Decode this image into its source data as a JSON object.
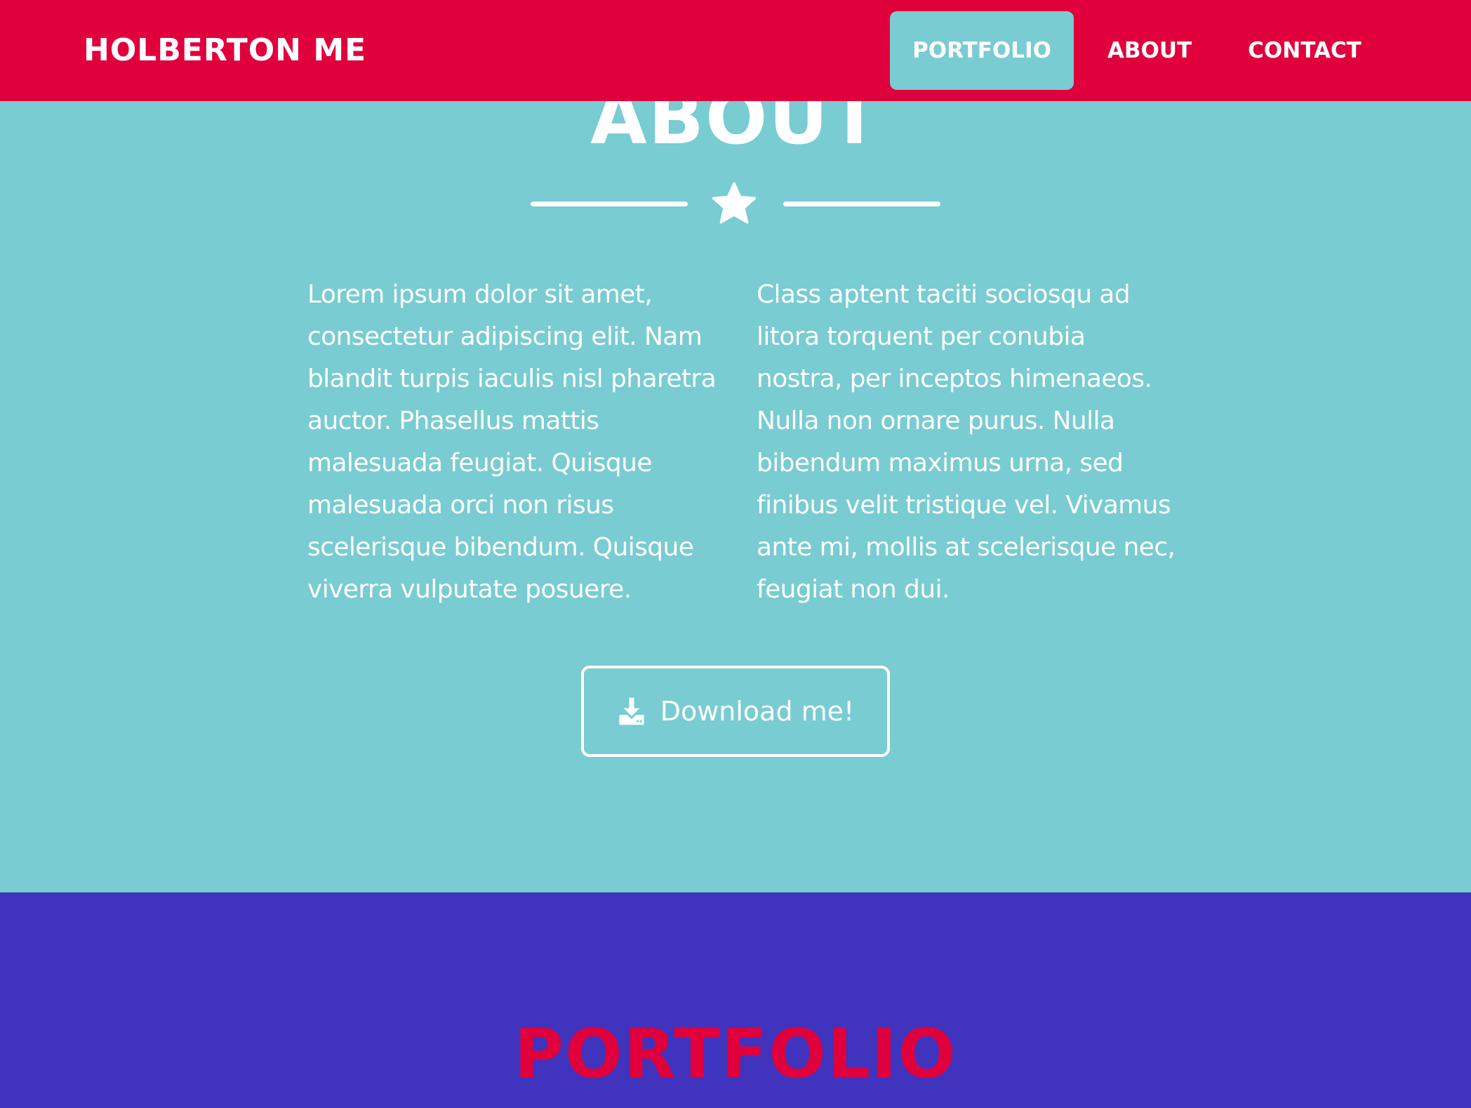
{
  "navbar": {
    "brand": "HOLBERTON ME",
    "links": [
      {
        "label": "PORTFOLIO",
        "active": true
      },
      {
        "label": "ABOUT",
        "active": false
      },
      {
        "label": "CONTACT",
        "active": false
      }
    ]
  },
  "about": {
    "title": "ABOUT",
    "divider_icon": "star-icon",
    "paragraph_left": "Lorem ipsum dolor sit amet, consectetur adipiscing elit. Nam blandit turpis iaculis nisl pharetra auctor. Phasellus mattis malesuada feugiat. Quisque malesuada orci non risus scelerisque bibendum. Quisque viverra vulputate posuere.",
    "paragraph_right": "Class aptent taciti sociosqu ad litora torquent per conubia nostra, per inceptos himenaeos. Nulla non ornare purus. Nulla bibendum maximus urna, sed finibus velit tristique vel. Vivamus ante mi, mollis at scelerisque nec, feugiat non dui.",
    "download_button": {
      "icon": "download-icon",
      "label": "Download me!"
    }
  },
  "portfolio": {
    "title": "PORTFOLIO"
  },
  "colors": {
    "navbar_bg": "#e0003c",
    "about_bg": "#78ccd2",
    "portfolio_bg": "#4033bd",
    "portfolio_title": "#e0003c",
    "text": "#ffffff"
  }
}
